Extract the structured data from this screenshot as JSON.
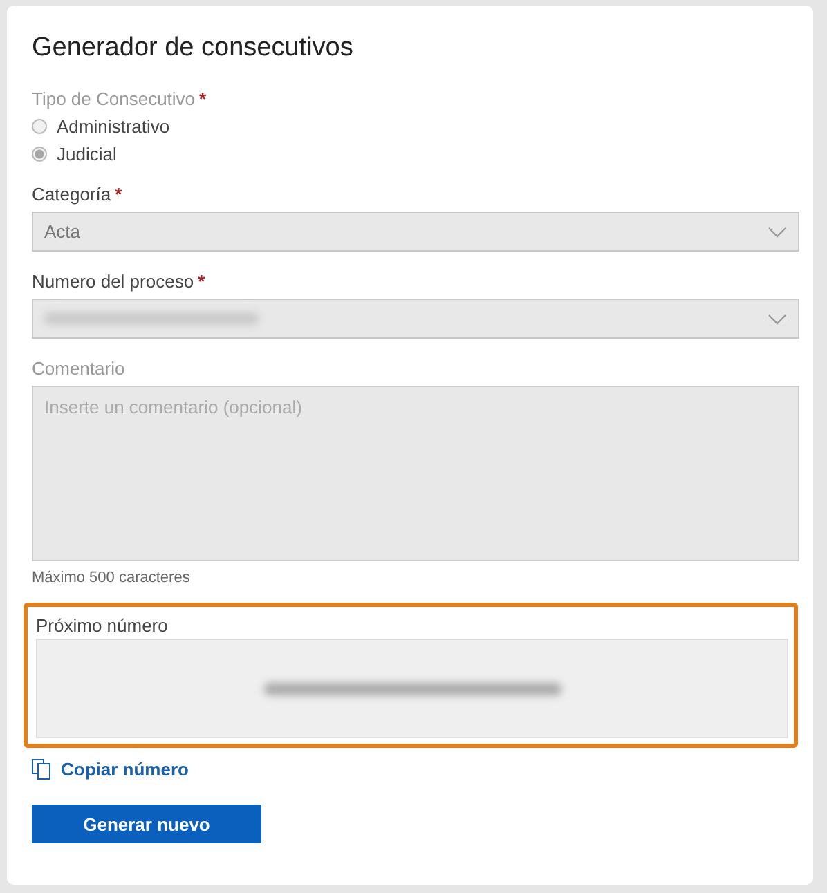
{
  "title": "Generador de consecutivos",
  "tipo": {
    "label": "Tipo de Consecutivo",
    "required_mark": "*",
    "disabled": true,
    "options": [
      {
        "label": "Administrativo",
        "selected": false
      },
      {
        "label": "Judicial",
        "selected": true
      }
    ]
  },
  "categoria": {
    "label": "Categoría",
    "required_mark": "*",
    "value": "Acta",
    "disabled": true
  },
  "proceso": {
    "label": "Numero del proceso",
    "required_mark": "*",
    "redacted": true,
    "disabled": true
  },
  "comentario": {
    "label": "Comentario",
    "placeholder": "Inserte un comentario (opcional)",
    "hint": "Máximo 500 caracteres",
    "disabled": true
  },
  "proximo": {
    "label": "Próximo número",
    "redacted": true,
    "highlighted": true
  },
  "copy_link": "Copiar número",
  "button": "Generar nuevo"
}
